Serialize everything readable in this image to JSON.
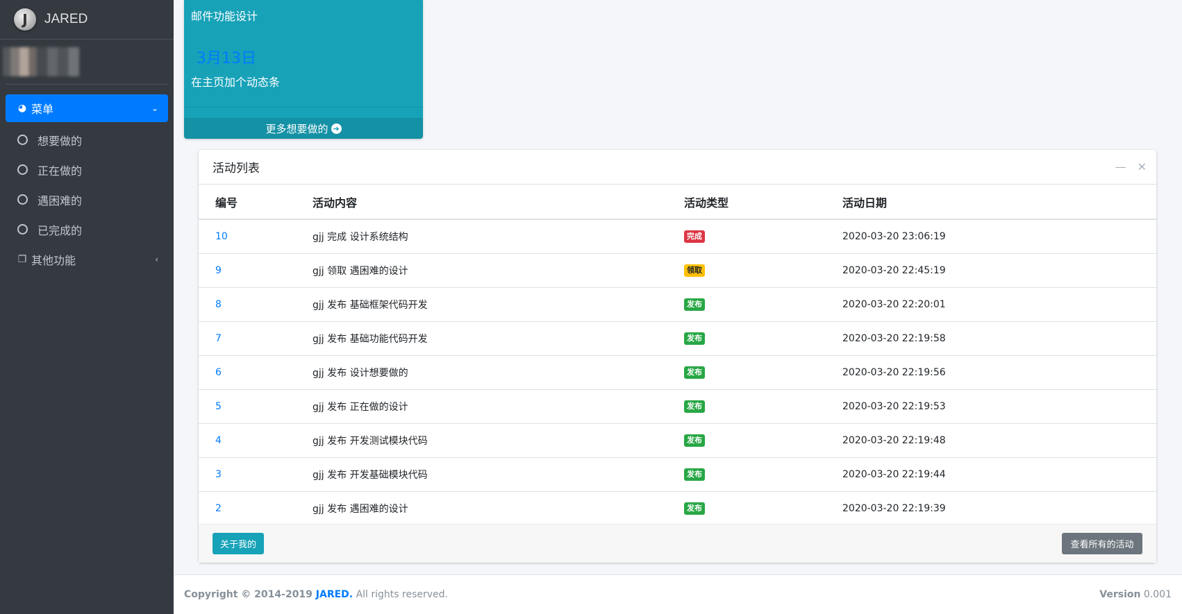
{
  "brand": {
    "logo_letter": "J",
    "name": "JARED"
  },
  "sidebar": {
    "menu_label": "菜单",
    "items": [
      {
        "label": "想要做的"
      },
      {
        "label": "正在做的"
      },
      {
        "label": "遇困难的"
      },
      {
        "label": "已完成的"
      }
    ],
    "other_label": "其他功能"
  },
  "info_card": {
    "title": "邮件功能设计",
    "date": "3月13日",
    "desc": "在主页加个动态条",
    "more_label": "更多想要做的"
  },
  "activity": {
    "title": "活动列表",
    "columns": [
      "编号",
      "活动内容",
      "活动类型",
      "活动日期"
    ],
    "rows": [
      {
        "id": "10",
        "content": "gjj 完成 设计系统结构",
        "type": "完成",
        "type_color": "#dc3545",
        "type_text_color": "#ffffff",
        "date": "2020-03-20 23:06:19"
      },
      {
        "id": "9",
        "content": "gjj 领取 遇困难的设计",
        "type": "领取",
        "type_color": "#ffc107",
        "type_text_color": "#212529",
        "date": "2020-03-20 22:45:19"
      },
      {
        "id": "8",
        "content": "gjj 发布 基础框架代码开发",
        "type": "发布",
        "type_color": "#28a745",
        "type_text_color": "#ffffff",
        "date": "2020-03-20 22:20:01"
      },
      {
        "id": "7",
        "content": "gjj 发布 基础功能代码开发",
        "type": "发布",
        "type_color": "#28a745",
        "type_text_color": "#ffffff",
        "date": "2020-03-20 22:19:58"
      },
      {
        "id": "6",
        "content": "gjj 发布 设计想要做的",
        "type": "发布",
        "type_color": "#28a745",
        "type_text_color": "#ffffff",
        "date": "2020-03-20 22:19:56"
      },
      {
        "id": "5",
        "content": "gjj 发布 正在做的设计",
        "type": "发布",
        "type_color": "#28a745",
        "type_text_color": "#ffffff",
        "date": "2020-03-20 22:19:53"
      },
      {
        "id": "4",
        "content": "gjj 发布 开发测试模块代码",
        "type": "发布",
        "type_color": "#28a745",
        "type_text_color": "#ffffff",
        "date": "2020-03-20 22:19:48"
      },
      {
        "id": "3",
        "content": "gjj 发布 开发基础模块代码",
        "type": "发布",
        "type_color": "#28a745",
        "type_text_color": "#ffffff",
        "date": "2020-03-20 22:19:44"
      },
      {
        "id": "2",
        "content": "gjj 发布 遇困难的设计",
        "type": "发布",
        "type_color": "#28a745",
        "type_text_color": "#ffffff",
        "date": "2020-03-20 22:19:39"
      }
    ],
    "about_label": "关于我的",
    "view_all_label": "查看所有的活动"
  },
  "footer": {
    "copyright_prefix": "Copyright © 2014-2019 ",
    "brand": "JARED.",
    "rights": " All rights reserved.",
    "version_label": "Version",
    "version": " 0.001"
  },
  "colors": {
    "sidebar_bg": "#343a40",
    "primary": "#007bff",
    "info": "#17a2b8",
    "secondary": "#6c757d"
  }
}
